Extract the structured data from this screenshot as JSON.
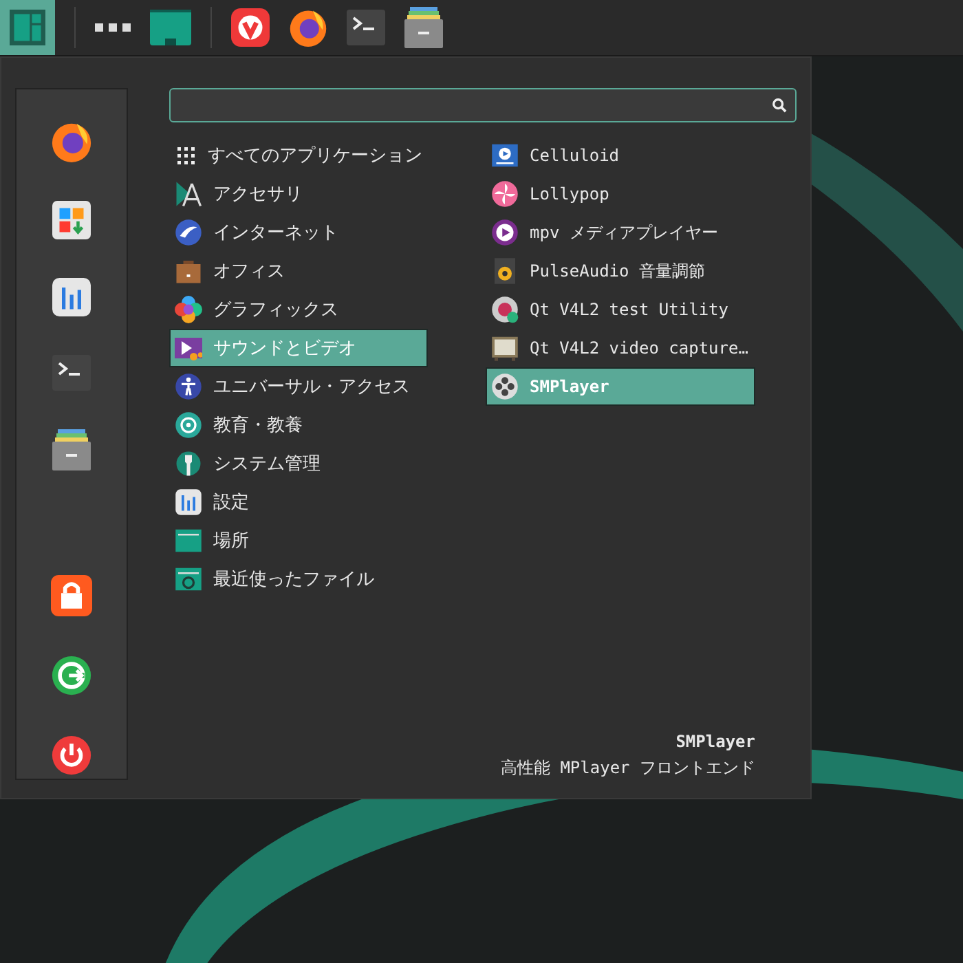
{
  "taskbar": {
    "menu_button": {
      "active": true
    }
  },
  "categories": [
    {
      "label": "すべてのアプリケーション",
      "selected": false
    },
    {
      "label": "アクセサリ",
      "selected": false
    },
    {
      "label": "インターネット",
      "selected": false
    },
    {
      "label": "オフィス",
      "selected": false
    },
    {
      "label": "グラフィックス",
      "selected": false
    },
    {
      "label": "サウンドとビデオ",
      "selected": true
    },
    {
      "label": "ユニバーサル・アクセス",
      "selected": false
    },
    {
      "label": "教育・教養",
      "selected": false
    },
    {
      "label": "システム管理",
      "selected": false
    },
    {
      "label": "設定",
      "selected": false
    },
    {
      "label": "場所",
      "selected": false
    },
    {
      "label": "最近使ったファイル",
      "selected": false
    }
  ],
  "apps": [
    {
      "label": "Celluloid",
      "selected": false
    },
    {
      "label": "Lollypop",
      "selected": false
    },
    {
      "label": "mpv メディアプレイヤー",
      "selected": false
    },
    {
      "label": "PulseAudio 音量調節",
      "selected": false
    },
    {
      "label": "Qt V4L2 test Utility",
      "selected": false
    },
    {
      "label": "Qt V4L2 video capture…",
      "selected": false
    },
    {
      "label": "SMPlayer",
      "selected": true
    }
  ],
  "description": {
    "title": "SMPlayer",
    "text": "高性能 MPlayer フロントエンド"
  }
}
